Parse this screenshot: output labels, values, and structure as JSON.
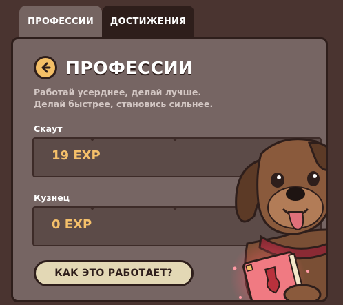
{
  "tabs": [
    {
      "label": "ПРОФЕССИИ",
      "active": true
    },
    {
      "label": "ДОСТИЖЕНИЯ",
      "active": false
    }
  ],
  "panel": {
    "title": "ПРОФЕССИИ",
    "back_icon": "arrow-left-icon",
    "subtitle_lines": [
      "Работай усерднее, делай лучше.",
      "Делай быстрее, становись сильнее."
    ],
    "professions": [
      {
        "name": "Скаут",
        "value": "19 EXP"
      },
      {
        "name": "Кузнец",
        "value": "0 EXP"
      }
    ],
    "how_button_label": "КАК ЭТО РАБОТАЕТ?"
  },
  "colors": {
    "background": "#4a3430",
    "panel": "#766563",
    "active_tab": "#756461",
    "inactive_tab": "#2e1e1b",
    "exp_text": "#f5c06a",
    "back_button": "#f4bf66",
    "how_button": "#e3d8b5"
  },
  "mascot": {
    "icon": "dog-with-book-icon"
  }
}
